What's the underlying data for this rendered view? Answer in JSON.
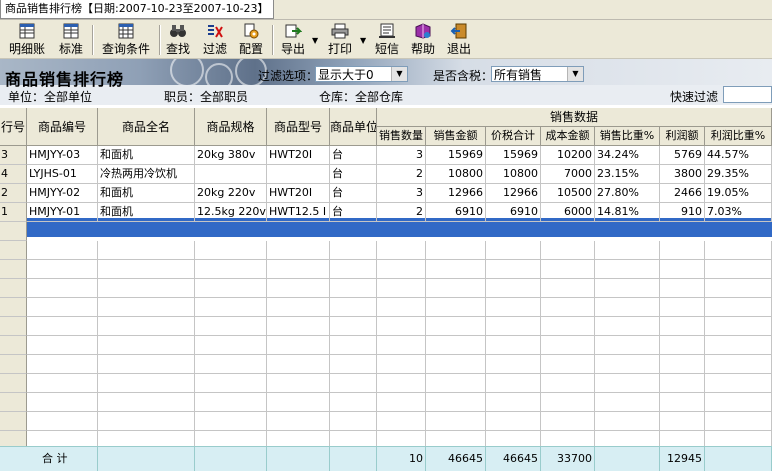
{
  "window": {
    "tab_title": "商品销售排行榜【日期:2007-10-23至2007-10-23】"
  },
  "toolbar": {
    "buttons": [
      {
        "label": "明细账",
        "icon": "ledger-icon"
      },
      {
        "label": "标准",
        "icon": "standard-icon"
      },
      {
        "label": "查询条件",
        "icon": "query-icon"
      },
      {
        "label": "查找",
        "icon": "binoculars-icon"
      },
      {
        "label": "过滤",
        "icon": "filter-icon"
      },
      {
        "label": "配置",
        "icon": "config-icon"
      },
      {
        "label": "导出",
        "icon": "export-icon"
      },
      {
        "label": "打印",
        "icon": "printer-icon"
      },
      {
        "label": "短信",
        "icon": "sms-icon"
      },
      {
        "label": "帮助",
        "icon": "help-icon"
      },
      {
        "label": "退出",
        "icon": "exit-icon"
      }
    ]
  },
  "header": {
    "title": "商品销售排行榜",
    "filter_label": "过滤选项：",
    "filter_value": "显示大于0",
    "tax_label": "是否含税：",
    "tax_value": "所有销售",
    "unit_text": "单位：全部单位",
    "staff_text": "职员：全部职员",
    "warehouse_text": "仓库：全部仓库",
    "quick_filter_label": "快速过滤"
  },
  "grid": {
    "group_header": "销售数据",
    "columns": [
      "行号",
      "商品编号",
      "商品全名",
      "商品规格",
      "商品型号",
      "商品单位",
      "销售数量",
      "销售金额",
      "价税合计",
      "成本金额",
      "销售比重%",
      "利润额",
      "利润比重%"
    ],
    "rows": [
      {
        "no": "3",
        "code": "HMJYY-03",
        "name": "和面机",
        "spec": "20kg 380v",
        "model": "HWT20I",
        "unit": "台",
        "qty": "3",
        "amount": "15969",
        "total": "15969",
        "cost": "10200",
        "ratio": "34.24%",
        "profit": "5769",
        "profit_ratio": "44.57%"
      },
      {
        "no": "4",
        "code": "LYJHS-01",
        "name": "冷热两用冷饮机",
        "spec": "",
        "model": "",
        "unit": "台",
        "qty": "2",
        "amount": "10800",
        "total": "10800",
        "cost": "7000",
        "ratio": "23.15%",
        "profit": "3800",
        "profit_ratio": "29.35%"
      },
      {
        "no": "2",
        "code": "HMJYY-02",
        "name": "和面机",
        "spec": "20kg  220v",
        "model": "HWT20I",
        "unit": "台",
        "qty": "3",
        "amount": "12966",
        "total": "12966",
        "cost": "10500",
        "ratio": "27.80%",
        "profit": "2466",
        "profit_ratio": "19.05%"
      },
      {
        "no": "1",
        "code": "HMJYY-01",
        "name": "和面机",
        "spec": "12.5kg 220v",
        "model": "HWT12.5 I",
        "unit": "台",
        "qty": "2",
        "amount": "6910",
        "total": "6910",
        "cost": "6000",
        "ratio": "14.81%",
        "profit": "910",
        "profit_ratio": "7.03%"
      }
    ],
    "summary": {
      "label": "合  计",
      "qty": "10",
      "amount": "46645",
      "total": "46645",
      "cost": "33700",
      "profit": "12945"
    }
  }
}
